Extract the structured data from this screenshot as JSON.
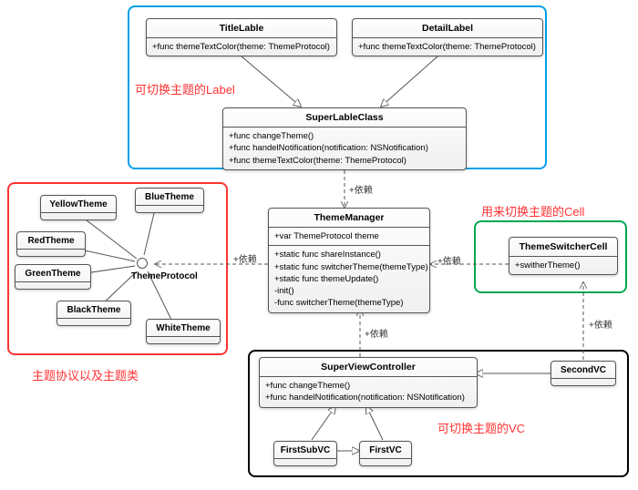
{
  "groups": {
    "label_group": {
      "title": "可切换主题的Label",
      "color": "#00a0e9"
    },
    "theme_group": {
      "title": "主题协议以及主题类",
      "color": "#ff3333"
    },
    "cell_group": {
      "title": "用来切换主题的Cell",
      "color": "#00a651"
    },
    "vc_group": {
      "title": "可切换主题的VC",
      "color": "#000000"
    }
  },
  "classes": {
    "TitleLable": {
      "name": "TitleLable",
      "methods": [
        "+func themeTextColor(theme: ThemeProtocol)"
      ]
    },
    "DetailLabel": {
      "name": "DetailLabel",
      "methods": [
        "+func themeTextColor(theme: ThemeProtocol)"
      ]
    },
    "SuperLableClass": {
      "name": "SuperLableClass",
      "methods": [
        "+func changeTheme()",
        "+func handelNotification(notification: NSNotification)",
        "+func themeTextColor(theme: ThemeProtocol)"
      ]
    },
    "ThemeManager": {
      "name": "ThemeManager",
      "attrs": [
        "+var ThemeProtocol theme"
      ],
      "methods": [
        "+static func shareInstance()",
        "+static func switcherTheme(themeType)",
        "+static func themeUpdate()",
        "-init()",
        "-func switcherTheme(themeType)"
      ]
    },
    "ThemeSwitcherCell": {
      "name": "ThemeSwitcherCell",
      "methods": [
        "+switherTheme()"
      ]
    },
    "SuperViewController": {
      "name": "SuperViewController",
      "methods": [
        "+func changeTheme()",
        "+func handelNotification(notification: NSNotification)"
      ]
    },
    "YellowTheme": "YellowTheme",
    "BlueTheme": "BlueTheme",
    "RedTheme": "RedTheme",
    "GreenTheme": "GreenTheme",
    "BlackTheme": "BlackTheme",
    "WhiteTheme": "WhiteTheme",
    "ThemeProtocol": "ThemeProtocol",
    "FirstSubVC": "FirstSubVC",
    "FirstVC": "FirstVC",
    "SecondVC": "SecondVC"
  },
  "labels": {
    "dep": "+依赖"
  },
  "chart_data": {
    "type": "uml_class_diagram",
    "classes": [
      {
        "name": "TitleLable",
        "section": [
          "+func themeTextColor(theme: ThemeProtocol)"
        ]
      },
      {
        "name": "DetailLabel",
        "section": [
          "+func themeTextColor(theme: ThemeProtocol)"
        ]
      },
      {
        "name": "SuperLableClass",
        "section": [
          "+func changeTheme()",
          "+func handelNotification(notification: NSNotification)",
          "+func themeTextColor(theme: ThemeProtocol)"
        ]
      },
      {
        "name": "ThemeManager",
        "attrs": [
          "+var ThemeProtocol theme"
        ],
        "section": [
          "+static func shareInstance()",
          "+static func switcherTheme(themeType)",
          "+static func themeUpdate()",
          "-init()",
          "-func switcherTheme(themeType)"
        ]
      },
      {
        "name": "ThemeSwitcherCell",
        "section": [
          "+switherTheme()"
        ]
      },
      {
        "name": "SuperViewController",
        "section": [
          "+func changeTheme()",
          "+func handelNotification(notification: NSNotification)"
        ]
      },
      {
        "name": "YellowTheme"
      },
      {
        "name": "BlueTheme"
      },
      {
        "name": "RedTheme"
      },
      {
        "name": "GreenTheme"
      },
      {
        "name": "BlackTheme"
      },
      {
        "name": "WhiteTheme"
      },
      {
        "name": "ThemeProtocol",
        "stereotype": "interface"
      },
      {
        "name": "FirstSubVC"
      },
      {
        "name": "FirstVC"
      },
      {
        "name": "SecondVC"
      }
    ],
    "relationships": [
      {
        "from": "TitleLable",
        "to": "SuperLableClass",
        "type": "generalization"
      },
      {
        "from": "DetailLabel",
        "to": "SuperLableClass",
        "type": "generalization"
      },
      {
        "from": "SuperLableClass",
        "to": "ThemeManager",
        "type": "dependency",
        "label": "+依赖"
      },
      {
        "from": "ThemeManager",
        "to": "ThemeProtocol",
        "type": "dependency",
        "label": "+依赖"
      },
      {
        "from": "ThemeSwitcherCell",
        "to": "ThemeManager",
        "type": "dependency",
        "label": "+依赖"
      },
      {
        "from": "SuperViewController",
        "to": "ThemeManager",
        "type": "dependency",
        "label": "+依赖"
      },
      {
        "from": "SecondVC",
        "to": "ThemeSwitcherCell",
        "type": "dependency",
        "label": "+依赖"
      },
      {
        "from": "SecondVC",
        "to": "SuperViewController",
        "type": "generalization"
      },
      {
        "from": "FirstSubVC",
        "to": "SuperViewController",
        "type": "generalization"
      },
      {
        "from": "FirstVC",
        "to": "SuperViewController",
        "type": "generalization"
      },
      {
        "from": "FirstSubVC",
        "to": "FirstVC",
        "type": "generalization"
      },
      {
        "from": "YellowTheme",
        "to": "ThemeProtocol",
        "type": "realization"
      },
      {
        "from": "BlueTheme",
        "to": "ThemeProtocol",
        "type": "realization"
      },
      {
        "from": "RedTheme",
        "to": "ThemeProtocol",
        "type": "realization"
      },
      {
        "from": "GreenTheme",
        "to": "ThemeProtocol",
        "type": "realization"
      },
      {
        "from": "BlackTheme",
        "to": "ThemeProtocol",
        "type": "realization"
      },
      {
        "from": "WhiteTheme",
        "to": "ThemeProtocol",
        "type": "realization"
      }
    ],
    "groups": [
      {
        "title": "可切换主题的Label",
        "color": "#00a0e9",
        "members": [
          "TitleLable",
          "DetailLabel",
          "SuperLableClass"
        ]
      },
      {
        "title": "主题协议以及主题类",
        "color": "#ff3333",
        "members": [
          "YellowTheme",
          "BlueTheme",
          "RedTheme",
          "GreenTheme",
          "BlackTheme",
          "WhiteTheme",
          "ThemeProtocol"
        ]
      },
      {
        "title": "用来切换主题的Cell",
        "color": "#00a651",
        "members": [
          "ThemeSwitcherCell"
        ]
      },
      {
        "title": "可切换主题的VC",
        "color": "#000000",
        "members": [
          "SuperViewController",
          "FirstSubVC",
          "FirstVC",
          "SecondVC"
        ]
      }
    ]
  }
}
